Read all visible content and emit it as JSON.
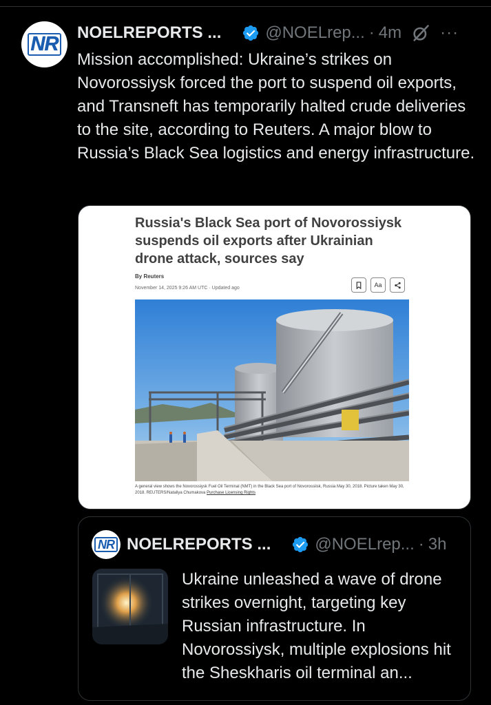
{
  "tweet": {
    "author": "NOELREPORTS ...",
    "handle": "@NOELrep...",
    "separator": "·",
    "time": "4m",
    "more": "···",
    "text": "Mission accomplished: Ukraine’s strikes on Novorossiysk forced the port to suspend oil exports, and Transneft has temporarily halted crude deliveries to the site, according to Reuters. A major blow to Russia’s Black Sea logistics and energy infrastructure.",
    "avatar_text": "NR"
  },
  "article": {
    "title": "Russia's Black Sea port of Novorossiysk suspends oil exports after Ukrainian drone attack, sources say",
    "byline": "By Reuters",
    "dateline": "November 14, 2025 9:26 AM UTC · Updated ago",
    "tool_text_size": "Aa",
    "caption": "A general view shows the Novorossiysk Fuel Oil Terminal (NMT) in the Black Sea port of Novorossiisk, Russia May 30, 2018. Picture taken May 30, 2018. REUTERS/Nataliya Chumakova",
    "caption_link": "Purchase Licensing Rights"
  },
  "quote": {
    "author": "NOELREPORTS ...",
    "handle": "@NOELrep...",
    "separator": "·",
    "time": "3h",
    "avatar_text": "NR",
    "text": "Ukraine unleashed a wave of drone strikes overnight, targeting key Russian infrastructure. In Novorossiysk, multiple explosions hit the Sheskharis oil terminal an..."
  },
  "colors": {
    "background": "#000000",
    "text": "#e7e9ea",
    "muted": "#71767b",
    "verified": "#1d9bf0",
    "border": "#2f3336"
  }
}
